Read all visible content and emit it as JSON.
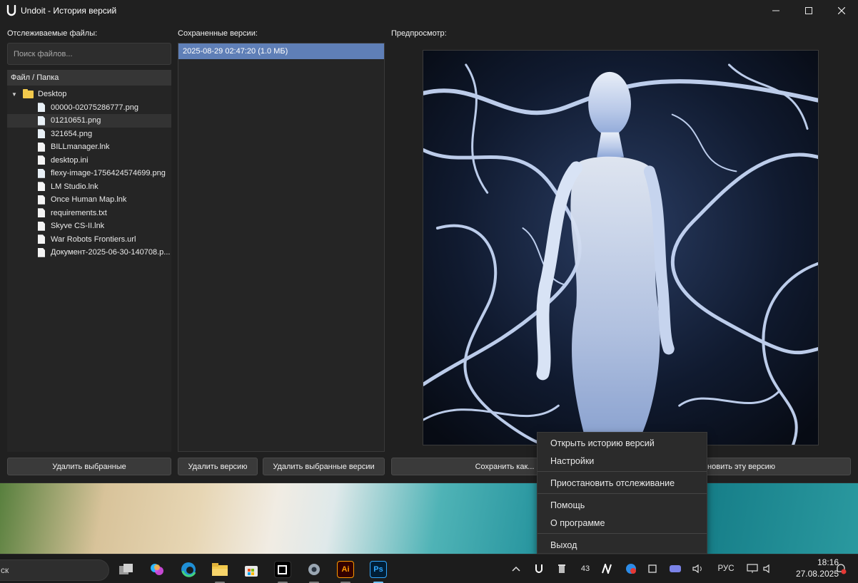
{
  "window": {
    "title": "Undoit - История версий",
    "controls": {
      "minimize_icon": "minimize-icon",
      "maximize_icon": "maximize-icon",
      "close_icon": "close-icon"
    }
  },
  "tracked": {
    "label": "Отслеживаемые файлы:",
    "search_placeholder": "Поиск файлов...",
    "tree_header": "Файл / Папка",
    "folder": "Desktop",
    "files": [
      "00000-02075286777.png",
      "01210651.png",
      "321654.png",
      "BILLmanager.lnk",
      "desktop.ini",
      "flexy-image-1756424574699.png",
      "LM Studio.lnk",
      "Once Human Map.lnk",
      "requirements.txt",
      "Skyve CS-II.lnk",
      "War Robots Frontiers.url",
      "Документ-2025-06-30-140708.p..."
    ],
    "selected_index": 1,
    "delete_selected_button": "Удалить выбранные"
  },
  "versions": {
    "label": "Сохраненные версии:",
    "items": [
      "2025-08-29 02:47:20 (1.0 МБ)"
    ],
    "delete_version_button": "Удалить версию",
    "delete_selected_versions_button": "Удалить выбранные версии"
  },
  "preview": {
    "label": "Предпросмотр:",
    "save_as_button": "Сохранить как...",
    "restore_button": "тановить эту версию"
  },
  "context_menu": {
    "items": [
      "Открыть историю версий",
      "Настройки",
      "Приостановить отслеживание",
      "Помощь",
      "О программе",
      "Выход"
    ]
  },
  "taskbar": {
    "search_text": "ск",
    "apps": [
      "task-view-icon",
      "copilot-icon",
      "edge-icon",
      "file-explorer-icon",
      "store-icon",
      "capcut-icon",
      "settings-icon",
      "illustrator-icon",
      "photoshop-icon"
    ],
    "illustrator_label": "Ai",
    "photoshop_label": "Ps",
    "tray": {
      "language": "РУС",
      "badge_count": "43",
      "time": "18:16",
      "date": "27.08.2025"
    }
  },
  "colors": {
    "window_bg": "#202020",
    "selection": "#5f7fb7",
    "button_bg": "#3a3a3a",
    "taskbar_bg": "#1c1c1c"
  }
}
